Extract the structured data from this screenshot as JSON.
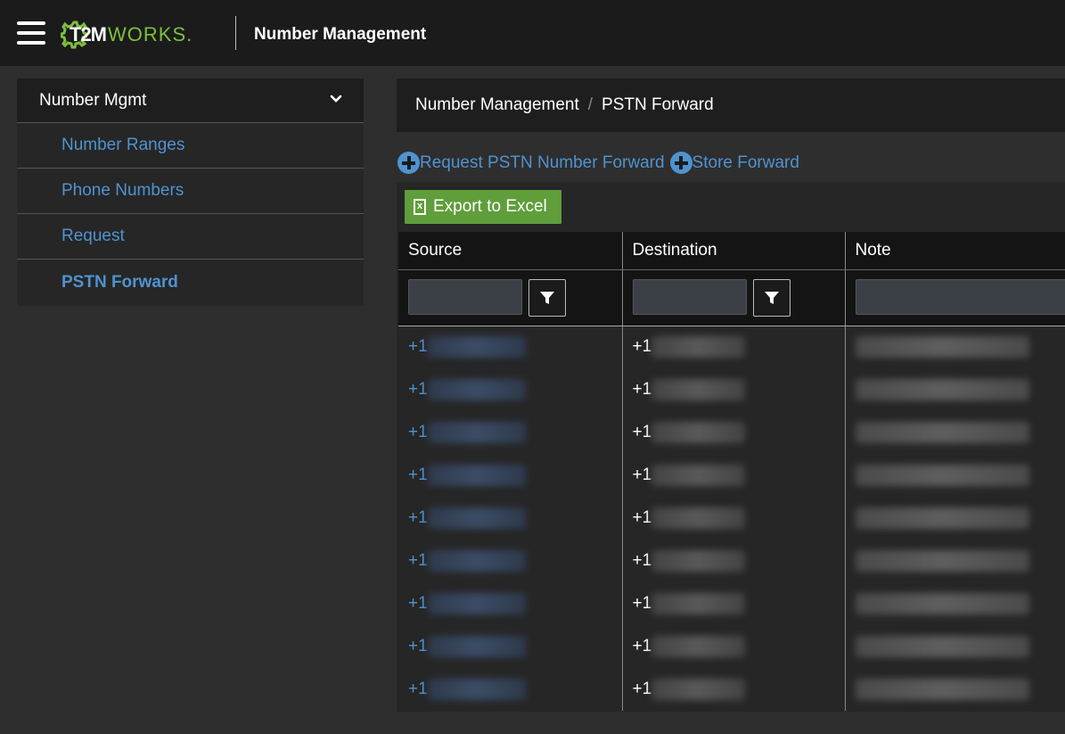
{
  "header": {
    "logo_t2m": "T2M",
    "logo_works": "WORKS.",
    "title": "Number Management"
  },
  "sidebar": {
    "header": "Number Mgmt",
    "items": [
      {
        "label": "Number Ranges"
      },
      {
        "label": "Phone Numbers"
      },
      {
        "label": "Request"
      },
      {
        "label": "PSTN Forward"
      }
    ]
  },
  "breadcrumb": {
    "parent": "Number Management",
    "separator": "/",
    "current": "PSTN Forward"
  },
  "actions": {
    "request_label": "Request PSTN Number Forward",
    "store_label": "Store Forward"
  },
  "grid": {
    "export_label": "Export to Excel",
    "columns": [
      "Source",
      "Destination",
      "Note"
    ],
    "rows": [
      {
        "source": "+1",
        "destination": "+1"
      },
      {
        "source": "+1",
        "destination": "+1"
      },
      {
        "source": "+1",
        "destination": "+1"
      },
      {
        "source": "+1",
        "destination": "+1"
      },
      {
        "source": "+1",
        "destination": "+1"
      },
      {
        "source": "+1",
        "destination": "+1"
      },
      {
        "source": "+1",
        "destination": "+1"
      },
      {
        "source": "+1",
        "destination": "+1"
      },
      {
        "source": "+1",
        "destination": "+1"
      }
    ]
  },
  "colors": {
    "accent_blue": "#4f93cf",
    "export_green": "#5f9e3a",
    "logo_green": "#7fbf3f"
  },
  "icons": [
    "menu-icon",
    "gear-logo-icon",
    "chevron-down-icon",
    "plus-circle-icon",
    "excel-icon",
    "filter-icon"
  ]
}
